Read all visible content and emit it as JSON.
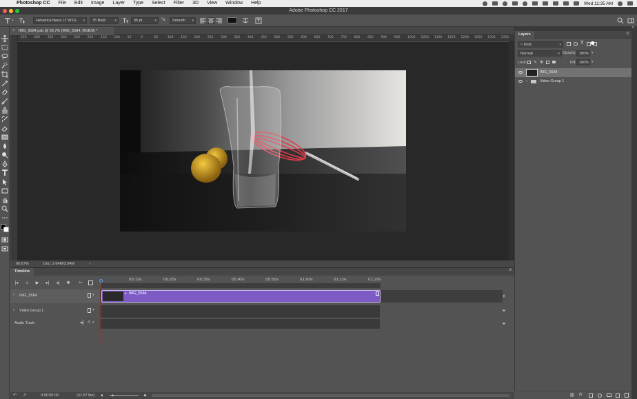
{
  "menubar": {
    "app": "Photoshop CC",
    "items": [
      "File",
      "Edit",
      "Image",
      "Layer",
      "Type",
      "Select",
      "Filter",
      "3D",
      "View",
      "Window",
      "Help"
    ],
    "clock": "Wed 11:35 AM"
  },
  "window": {
    "title": "Adobe Photoshop CC 2017"
  },
  "options": {
    "font_family": "Helvetica Neue LT W1G",
    "font_style": "75 Bold",
    "font_size": "35 pt",
    "antialias": "Smooth"
  },
  "document": {
    "tab_label": "IMG_5584.psb @ 66.7% (IMG_5584, RGB/8) *",
    "ruler_ticks": [
      "450",
      "400",
      "350",
      "300",
      "250",
      "200",
      "150",
      "100",
      "50",
      "0",
      "50",
      "100",
      "150",
      "200",
      "250",
      "300",
      "350",
      "400",
      "450",
      "500",
      "550",
      "600",
      "650",
      "700",
      "750",
      "800",
      "850",
      "900",
      "950",
      "1000",
      "1050",
      "1100",
      "1150",
      "1200",
      "1250",
      "1300",
      "1350",
      "1400"
    ],
    "zoom": "66.67%",
    "doc_info": "Doc: 2.64M/2.64M"
  },
  "layers_panel": {
    "tab": "Layers",
    "kind": "Kind",
    "blend_mode": "Normal",
    "opacity_label": "Opacity:",
    "opacity_value": "100%",
    "lock_label": "Lock:",
    "fill_label": "Fill:",
    "fill_value": "100%",
    "layers": [
      {
        "name": "IMG_5584",
        "selected": true
      },
      {
        "name": "Video Group 1",
        "selected": false
      }
    ]
  },
  "timeline": {
    "tab": "Timeline",
    "time_labels": [
      "00:10s",
      "00:20s",
      "00:30s",
      "00:40s",
      "00:50s",
      "01:00s",
      "01:10s",
      "01:20s"
    ],
    "tracks": [
      {
        "name": "IMG_5584"
      },
      {
        "name": "Video Group 1"
      },
      {
        "name": "Audio Track"
      }
    ],
    "clip_label": "IMG_5584",
    "current_time": "0:00:00:00",
    "fps": "(41.67 fps)"
  },
  "colors": {
    "clip": "#7c5cc4",
    "playhead": "#cc2222",
    "selected_layer": "#737373"
  }
}
